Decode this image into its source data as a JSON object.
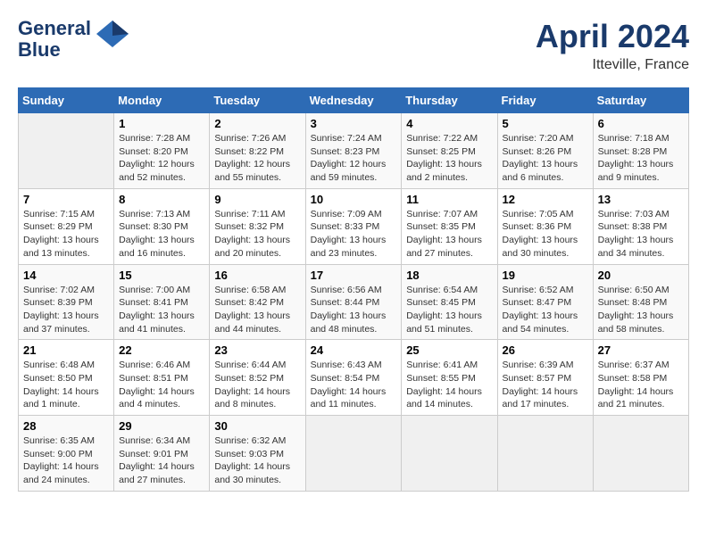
{
  "header": {
    "logo_line1": "General",
    "logo_line2": "Blue",
    "month": "April 2024",
    "location": "Itteville, France"
  },
  "days_of_week": [
    "Sunday",
    "Monday",
    "Tuesday",
    "Wednesday",
    "Thursday",
    "Friday",
    "Saturday"
  ],
  "weeks": [
    [
      {
        "day": "",
        "info": ""
      },
      {
        "day": "1",
        "info": "Sunrise: 7:28 AM\nSunset: 8:20 PM\nDaylight: 12 hours\nand 52 minutes."
      },
      {
        "day": "2",
        "info": "Sunrise: 7:26 AM\nSunset: 8:22 PM\nDaylight: 12 hours\nand 55 minutes."
      },
      {
        "day": "3",
        "info": "Sunrise: 7:24 AM\nSunset: 8:23 PM\nDaylight: 12 hours\nand 59 minutes."
      },
      {
        "day": "4",
        "info": "Sunrise: 7:22 AM\nSunset: 8:25 PM\nDaylight: 13 hours\nand 2 minutes."
      },
      {
        "day": "5",
        "info": "Sunrise: 7:20 AM\nSunset: 8:26 PM\nDaylight: 13 hours\nand 6 minutes."
      },
      {
        "day": "6",
        "info": "Sunrise: 7:18 AM\nSunset: 8:28 PM\nDaylight: 13 hours\nand 9 minutes."
      }
    ],
    [
      {
        "day": "7",
        "info": "Sunrise: 7:15 AM\nSunset: 8:29 PM\nDaylight: 13 hours\nand 13 minutes."
      },
      {
        "day": "8",
        "info": "Sunrise: 7:13 AM\nSunset: 8:30 PM\nDaylight: 13 hours\nand 16 minutes."
      },
      {
        "day": "9",
        "info": "Sunrise: 7:11 AM\nSunset: 8:32 PM\nDaylight: 13 hours\nand 20 minutes."
      },
      {
        "day": "10",
        "info": "Sunrise: 7:09 AM\nSunset: 8:33 PM\nDaylight: 13 hours\nand 23 minutes."
      },
      {
        "day": "11",
        "info": "Sunrise: 7:07 AM\nSunset: 8:35 PM\nDaylight: 13 hours\nand 27 minutes."
      },
      {
        "day": "12",
        "info": "Sunrise: 7:05 AM\nSunset: 8:36 PM\nDaylight: 13 hours\nand 30 minutes."
      },
      {
        "day": "13",
        "info": "Sunrise: 7:03 AM\nSunset: 8:38 PM\nDaylight: 13 hours\nand 34 minutes."
      }
    ],
    [
      {
        "day": "14",
        "info": "Sunrise: 7:02 AM\nSunset: 8:39 PM\nDaylight: 13 hours\nand 37 minutes."
      },
      {
        "day": "15",
        "info": "Sunrise: 7:00 AM\nSunset: 8:41 PM\nDaylight: 13 hours\nand 41 minutes."
      },
      {
        "day": "16",
        "info": "Sunrise: 6:58 AM\nSunset: 8:42 PM\nDaylight: 13 hours\nand 44 minutes."
      },
      {
        "day": "17",
        "info": "Sunrise: 6:56 AM\nSunset: 8:44 PM\nDaylight: 13 hours\nand 48 minutes."
      },
      {
        "day": "18",
        "info": "Sunrise: 6:54 AM\nSunset: 8:45 PM\nDaylight: 13 hours\nand 51 minutes."
      },
      {
        "day": "19",
        "info": "Sunrise: 6:52 AM\nSunset: 8:47 PM\nDaylight: 13 hours\nand 54 minutes."
      },
      {
        "day": "20",
        "info": "Sunrise: 6:50 AM\nSunset: 8:48 PM\nDaylight: 13 hours\nand 58 minutes."
      }
    ],
    [
      {
        "day": "21",
        "info": "Sunrise: 6:48 AM\nSunset: 8:50 PM\nDaylight: 14 hours\nand 1 minute."
      },
      {
        "day": "22",
        "info": "Sunrise: 6:46 AM\nSunset: 8:51 PM\nDaylight: 14 hours\nand 4 minutes."
      },
      {
        "day": "23",
        "info": "Sunrise: 6:44 AM\nSunset: 8:52 PM\nDaylight: 14 hours\nand 8 minutes."
      },
      {
        "day": "24",
        "info": "Sunrise: 6:43 AM\nSunset: 8:54 PM\nDaylight: 14 hours\nand 11 minutes."
      },
      {
        "day": "25",
        "info": "Sunrise: 6:41 AM\nSunset: 8:55 PM\nDaylight: 14 hours\nand 14 minutes."
      },
      {
        "day": "26",
        "info": "Sunrise: 6:39 AM\nSunset: 8:57 PM\nDaylight: 14 hours\nand 17 minutes."
      },
      {
        "day": "27",
        "info": "Sunrise: 6:37 AM\nSunset: 8:58 PM\nDaylight: 14 hours\nand 21 minutes."
      }
    ],
    [
      {
        "day": "28",
        "info": "Sunrise: 6:35 AM\nSunset: 9:00 PM\nDaylight: 14 hours\nand 24 minutes."
      },
      {
        "day": "29",
        "info": "Sunrise: 6:34 AM\nSunset: 9:01 PM\nDaylight: 14 hours\nand 27 minutes."
      },
      {
        "day": "30",
        "info": "Sunrise: 6:32 AM\nSunset: 9:03 PM\nDaylight: 14 hours\nand 30 minutes."
      },
      {
        "day": "",
        "info": ""
      },
      {
        "day": "",
        "info": ""
      },
      {
        "day": "",
        "info": ""
      },
      {
        "day": "",
        "info": ""
      }
    ]
  ]
}
